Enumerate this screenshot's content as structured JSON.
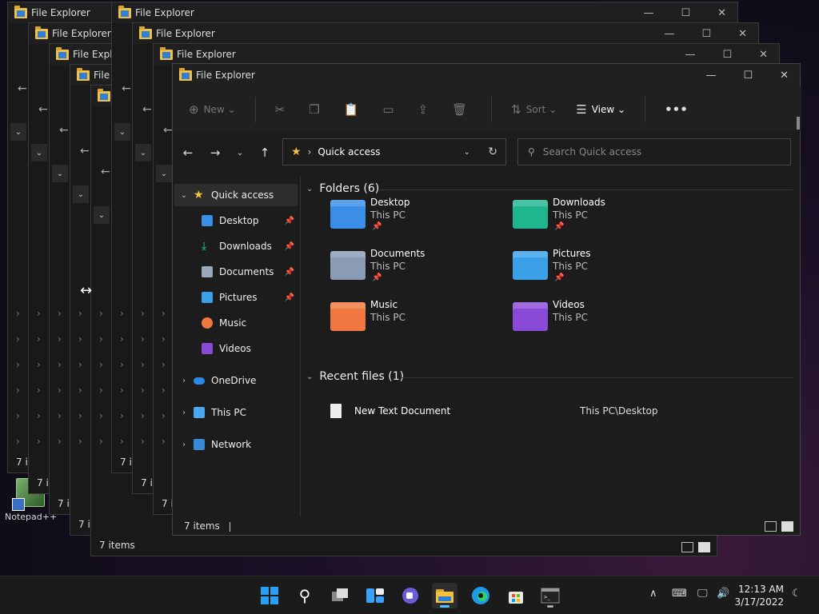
{
  "window_title": "File Explorer",
  "background_item_count": "7 items",
  "bg_truncated": "7 i",
  "desktop": {
    "icon_label": "Notepad++"
  },
  "main": {
    "title": "File Explorer",
    "commands": {
      "new": "New",
      "sort": "Sort",
      "view": "View"
    },
    "address": {
      "location": "Quick access"
    },
    "search": {
      "placeholder": "Search Quick access"
    },
    "nav": {
      "quick_access": "Quick access",
      "pinned": [
        "Desktop",
        "Downloads",
        "Documents",
        "Pictures"
      ],
      "unpinned": [
        "Music",
        "Videos"
      ],
      "onedrive": "OneDrive",
      "this_pc": "This PC",
      "network": "Network"
    },
    "folders_header": "Folders (6)",
    "folders": [
      {
        "name": "Desktop",
        "location": "This PC",
        "pinned": true,
        "color": "#3a8ee6"
      },
      {
        "name": "Downloads",
        "location": "This PC",
        "pinned": true,
        "color": "#1fb68f"
      },
      {
        "name": "Documents",
        "location": "This PC",
        "pinned": true,
        "color": "#8a9bb4"
      },
      {
        "name": "Pictures",
        "location": "This PC",
        "pinned": true,
        "color": "#3aa0e8"
      },
      {
        "name": "Music",
        "location": "This PC",
        "pinned": false,
        "color": "#f07840"
      },
      {
        "name": "Videos",
        "location": "This PC",
        "pinned": false,
        "color": "#8a4ad8"
      }
    ],
    "recent_header": "Recent files (1)",
    "recent": [
      {
        "name": "New Text Document",
        "path": "This PC\\Desktop"
      }
    ],
    "status": "7 items"
  },
  "taskbar": {
    "time": "12:13 AM",
    "date": "3/17/2022"
  },
  "colors": {
    "accent": "#f6c23b",
    "windows_blue": "#0a84ff"
  }
}
